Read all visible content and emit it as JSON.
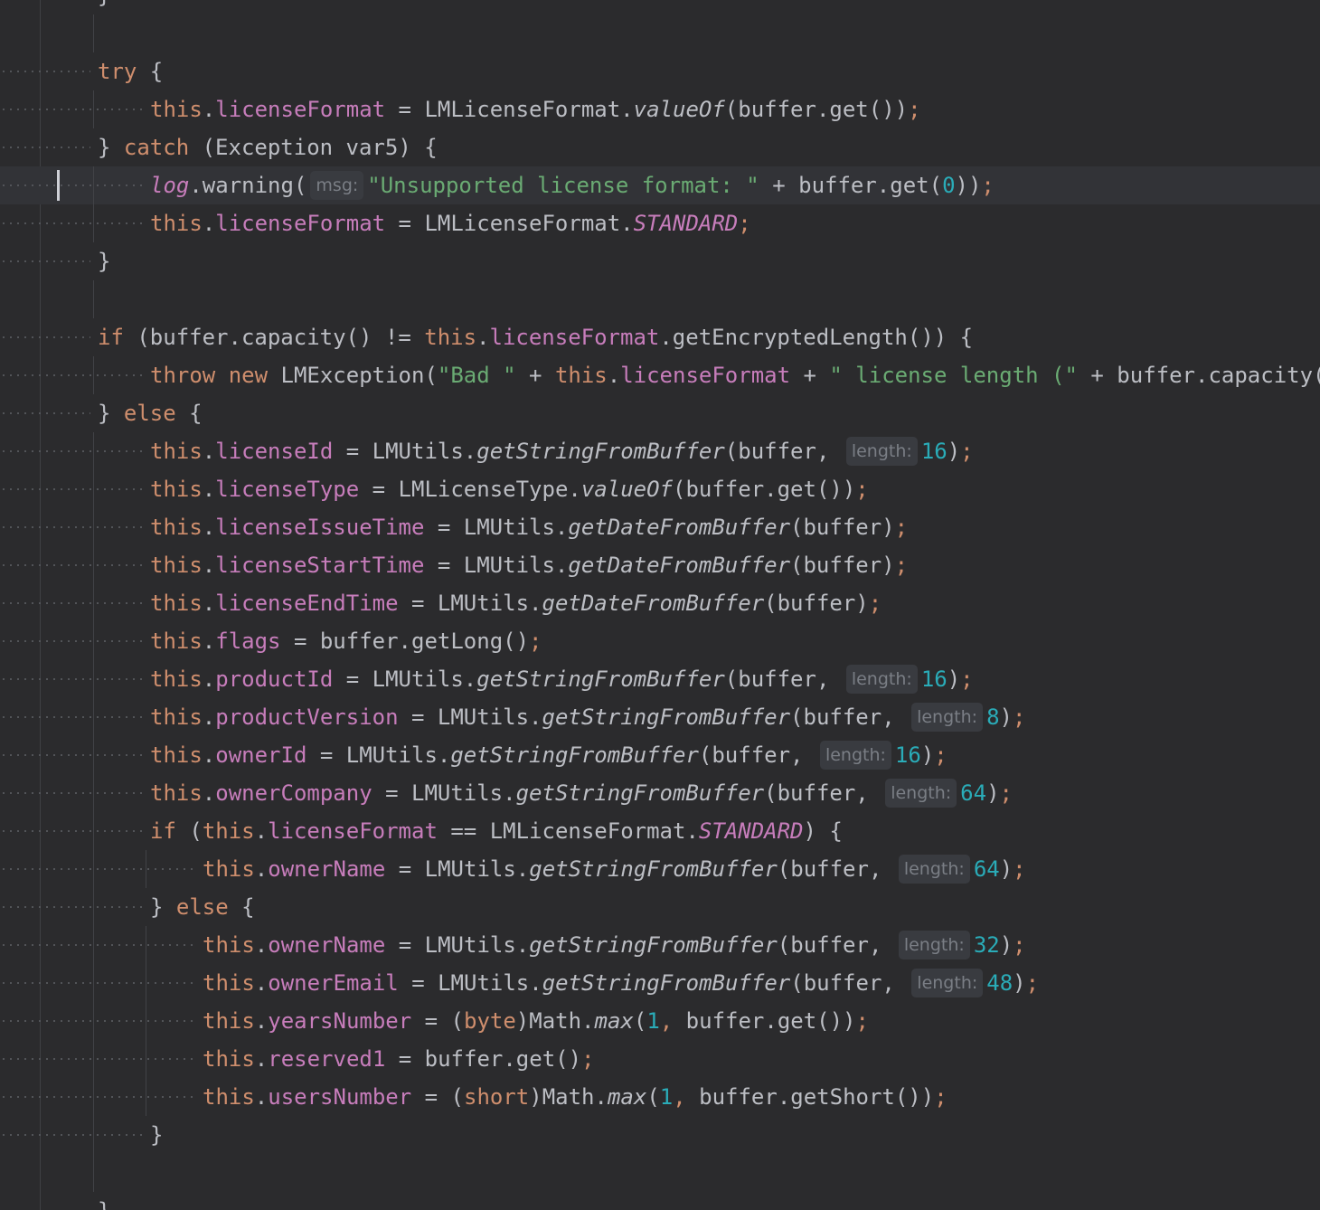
{
  "hint_labels": {
    "msg": "msg:",
    "length": "length:"
  },
  "lines": [
    [
      {
        "t": "p",
        "v": "}"
      }
    ],
    [],
    [
      {
        "t": "k",
        "v": "try"
      },
      {
        "t": "p",
        "v": " {"
      }
    ],
    [
      {
        "t": "k",
        "v": "this"
      },
      {
        "t": "p",
        "v": "."
      },
      {
        "t": "f",
        "v": "licenseFormat"
      },
      {
        "t": "p",
        "v": " = LMLicenseFormat."
      },
      {
        "t": "i",
        "v": "valueOf"
      },
      {
        "t": "p",
        "v": "(buffer.get())"
      },
      {
        "t": "k",
        "v": ";"
      }
    ],
    [
      {
        "t": "p",
        "v": "} "
      },
      {
        "t": "k",
        "v": "catch"
      },
      {
        "t": "p",
        "v": " (Exception var5) {"
      }
    ],
    [
      {
        "t": "s",
        "v": "log"
      },
      {
        "t": "p",
        "v": ".warning("
      },
      {
        "t": "h",
        "v": "msg"
      },
      {
        "t": "g",
        "v": "\"Unsupported license format: \""
      },
      {
        "t": "p",
        "v": " + buffer.get("
      },
      {
        "t": "n",
        "v": "0"
      },
      {
        "t": "p",
        "v": "))"
      },
      {
        "t": "k",
        "v": ";"
      }
    ],
    [
      {
        "t": "k",
        "v": "this"
      },
      {
        "t": "p",
        "v": "."
      },
      {
        "t": "f",
        "v": "licenseFormat"
      },
      {
        "t": "p",
        "v": " = LMLicenseFormat."
      },
      {
        "t": "s",
        "v": "STANDARD"
      },
      {
        "t": "k",
        "v": ";"
      }
    ],
    [
      {
        "t": "p",
        "v": "}"
      }
    ],
    [],
    [
      {
        "t": "k",
        "v": "if"
      },
      {
        "t": "p",
        "v": " (buffer.capacity() != "
      },
      {
        "t": "k",
        "v": "this"
      },
      {
        "t": "p",
        "v": "."
      },
      {
        "t": "f",
        "v": "licenseFormat"
      },
      {
        "t": "p",
        "v": ".getEncryptedLength()) {"
      }
    ],
    [
      {
        "t": "k",
        "v": "throw new"
      },
      {
        "t": "p",
        "v": " LMException("
      },
      {
        "t": "g",
        "v": "\"Bad \""
      },
      {
        "t": "p",
        "v": " + "
      },
      {
        "t": "k",
        "v": "this"
      },
      {
        "t": "p",
        "v": "."
      },
      {
        "t": "f",
        "v": "licenseFormat"
      },
      {
        "t": "p",
        "v": " + "
      },
      {
        "t": "g",
        "v": "\" license length (\""
      },
      {
        "t": "p",
        "v": " + buffer.capacity("
      }
    ],
    [
      {
        "t": "p",
        "v": "} "
      },
      {
        "t": "k",
        "v": "else"
      },
      {
        "t": "p",
        "v": " {"
      }
    ],
    [
      {
        "t": "k",
        "v": "this"
      },
      {
        "t": "p",
        "v": "."
      },
      {
        "t": "f",
        "v": "licenseId"
      },
      {
        "t": "p",
        "v": " = LMUtils."
      },
      {
        "t": "i",
        "v": "getStringFromBuffer"
      },
      {
        "t": "p",
        "v": "(buffer, "
      },
      {
        "t": "h",
        "v": "length"
      },
      {
        "t": "n",
        "v": "16"
      },
      {
        "t": "p",
        "v": ")"
      },
      {
        "t": "k",
        "v": ";"
      }
    ],
    [
      {
        "t": "k",
        "v": "this"
      },
      {
        "t": "p",
        "v": "."
      },
      {
        "t": "f",
        "v": "licenseType"
      },
      {
        "t": "p",
        "v": " = LMLicenseType."
      },
      {
        "t": "i",
        "v": "valueOf"
      },
      {
        "t": "p",
        "v": "(buffer.get())"
      },
      {
        "t": "k",
        "v": ";"
      }
    ],
    [
      {
        "t": "k",
        "v": "this"
      },
      {
        "t": "p",
        "v": "."
      },
      {
        "t": "f",
        "v": "licenseIssueTime"
      },
      {
        "t": "p",
        "v": " = LMUtils."
      },
      {
        "t": "i",
        "v": "getDateFromBuffer"
      },
      {
        "t": "p",
        "v": "(buffer)"
      },
      {
        "t": "k",
        "v": ";"
      }
    ],
    [
      {
        "t": "k",
        "v": "this"
      },
      {
        "t": "p",
        "v": "."
      },
      {
        "t": "f",
        "v": "licenseStartTime"
      },
      {
        "t": "p",
        "v": " = LMUtils."
      },
      {
        "t": "i",
        "v": "getDateFromBuffer"
      },
      {
        "t": "p",
        "v": "(buffer)"
      },
      {
        "t": "k",
        "v": ";"
      }
    ],
    [
      {
        "t": "k",
        "v": "this"
      },
      {
        "t": "p",
        "v": "."
      },
      {
        "t": "f",
        "v": "licenseEndTime"
      },
      {
        "t": "p",
        "v": " = LMUtils."
      },
      {
        "t": "i",
        "v": "getDateFromBuffer"
      },
      {
        "t": "p",
        "v": "(buffer)"
      },
      {
        "t": "k",
        "v": ";"
      }
    ],
    [
      {
        "t": "k",
        "v": "this"
      },
      {
        "t": "p",
        "v": "."
      },
      {
        "t": "f",
        "v": "flags"
      },
      {
        "t": "p",
        "v": " = buffer.getLong()"
      },
      {
        "t": "k",
        "v": ";"
      }
    ],
    [
      {
        "t": "k",
        "v": "this"
      },
      {
        "t": "p",
        "v": "."
      },
      {
        "t": "f",
        "v": "productId"
      },
      {
        "t": "p",
        "v": " = LMUtils."
      },
      {
        "t": "i",
        "v": "getStringFromBuffer"
      },
      {
        "t": "p",
        "v": "(buffer, "
      },
      {
        "t": "h",
        "v": "length"
      },
      {
        "t": "n",
        "v": "16"
      },
      {
        "t": "p",
        "v": ")"
      },
      {
        "t": "k",
        "v": ";"
      }
    ],
    [
      {
        "t": "k",
        "v": "this"
      },
      {
        "t": "p",
        "v": "."
      },
      {
        "t": "f",
        "v": "productVersion"
      },
      {
        "t": "p",
        "v": " = LMUtils."
      },
      {
        "t": "i",
        "v": "getStringFromBuffer"
      },
      {
        "t": "p",
        "v": "(buffer, "
      },
      {
        "t": "h",
        "v": "length"
      },
      {
        "t": "n",
        "v": "8"
      },
      {
        "t": "p",
        "v": ")"
      },
      {
        "t": "k",
        "v": ";"
      }
    ],
    [
      {
        "t": "k",
        "v": "this"
      },
      {
        "t": "p",
        "v": "."
      },
      {
        "t": "f",
        "v": "ownerId"
      },
      {
        "t": "p",
        "v": " = LMUtils."
      },
      {
        "t": "i",
        "v": "getStringFromBuffer"
      },
      {
        "t": "p",
        "v": "(buffer, "
      },
      {
        "t": "h",
        "v": "length"
      },
      {
        "t": "n",
        "v": "16"
      },
      {
        "t": "p",
        "v": ")"
      },
      {
        "t": "k",
        "v": ";"
      }
    ],
    [
      {
        "t": "k",
        "v": "this"
      },
      {
        "t": "p",
        "v": "."
      },
      {
        "t": "f",
        "v": "ownerCompany"
      },
      {
        "t": "p",
        "v": " = LMUtils."
      },
      {
        "t": "i",
        "v": "getStringFromBuffer"
      },
      {
        "t": "p",
        "v": "(buffer, "
      },
      {
        "t": "h",
        "v": "length"
      },
      {
        "t": "n",
        "v": "64"
      },
      {
        "t": "p",
        "v": ")"
      },
      {
        "t": "k",
        "v": ";"
      }
    ],
    [
      {
        "t": "k",
        "v": "if"
      },
      {
        "t": "p",
        "v": " ("
      },
      {
        "t": "k",
        "v": "this"
      },
      {
        "t": "p",
        "v": "."
      },
      {
        "t": "f",
        "v": "licenseFormat"
      },
      {
        "t": "p",
        "v": " == LMLicenseFormat."
      },
      {
        "t": "s",
        "v": "STANDARD"
      },
      {
        "t": "p",
        "v": ") {"
      }
    ],
    [
      {
        "t": "k",
        "v": "this"
      },
      {
        "t": "p",
        "v": "."
      },
      {
        "t": "f",
        "v": "ownerName"
      },
      {
        "t": "p",
        "v": " = LMUtils."
      },
      {
        "t": "i",
        "v": "getStringFromBuffer"
      },
      {
        "t": "p",
        "v": "(buffer, "
      },
      {
        "t": "h",
        "v": "length"
      },
      {
        "t": "n",
        "v": "64"
      },
      {
        "t": "p",
        "v": ")"
      },
      {
        "t": "k",
        "v": ";"
      }
    ],
    [
      {
        "t": "p",
        "v": "} "
      },
      {
        "t": "k",
        "v": "else"
      },
      {
        "t": "p",
        "v": " {"
      }
    ],
    [
      {
        "t": "k",
        "v": "this"
      },
      {
        "t": "p",
        "v": "."
      },
      {
        "t": "f",
        "v": "ownerName"
      },
      {
        "t": "p",
        "v": " = LMUtils."
      },
      {
        "t": "i",
        "v": "getStringFromBuffer"
      },
      {
        "t": "p",
        "v": "(buffer, "
      },
      {
        "t": "h",
        "v": "length"
      },
      {
        "t": "n",
        "v": "32"
      },
      {
        "t": "p",
        "v": ")"
      },
      {
        "t": "k",
        "v": ";"
      }
    ],
    [
      {
        "t": "k",
        "v": "this"
      },
      {
        "t": "p",
        "v": "."
      },
      {
        "t": "f",
        "v": "ownerEmail"
      },
      {
        "t": "p",
        "v": " = LMUtils."
      },
      {
        "t": "i",
        "v": "getStringFromBuffer"
      },
      {
        "t": "p",
        "v": "(buffer, "
      },
      {
        "t": "h",
        "v": "length"
      },
      {
        "t": "n",
        "v": "48"
      },
      {
        "t": "p",
        "v": ")"
      },
      {
        "t": "k",
        "v": ";"
      }
    ],
    [
      {
        "t": "k",
        "v": "this"
      },
      {
        "t": "p",
        "v": "."
      },
      {
        "t": "f",
        "v": "yearsNumber"
      },
      {
        "t": "p",
        "v": " = ("
      },
      {
        "t": "k",
        "v": "byte"
      },
      {
        "t": "p",
        "v": ")Math."
      },
      {
        "t": "i",
        "v": "max"
      },
      {
        "t": "p",
        "v": "("
      },
      {
        "t": "n",
        "v": "1"
      },
      {
        "t": "k",
        "v": ","
      },
      {
        "t": "p",
        "v": " buffer.get())"
      },
      {
        "t": "k",
        "v": ";"
      }
    ],
    [
      {
        "t": "k",
        "v": "this"
      },
      {
        "t": "p",
        "v": "."
      },
      {
        "t": "f",
        "v": "reserved1"
      },
      {
        "t": "p",
        "v": " = buffer.get()"
      },
      {
        "t": "k",
        "v": ";"
      }
    ],
    [
      {
        "t": "k",
        "v": "this"
      },
      {
        "t": "p",
        "v": "."
      },
      {
        "t": "f",
        "v": "usersNumber"
      },
      {
        "t": "p",
        "v": " = ("
      },
      {
        "t": "k",
        "v": "short"
      },
      {
        "t": "p",
        "v": ")Math."
      },
      {
        "t": "i",
        "v": "max"
      },
      {
        "t": "p",
        "v": "("
      },
      {
        "t": "n",
        "v": "1"
      },
      {
        "t": "k",
        "v": ","
      },
      {
        "t": "p",
        "v": " buffer.getShort())"
      },
      {
        "t": "k",
        "v": ";"
      }
    ],
    [
      {
        "t": "p",
        "v": "}"
      }
    ],
    [],
    [
      {
        "t": "p",
        "v": "}"
      }
    ]
  ]
}
